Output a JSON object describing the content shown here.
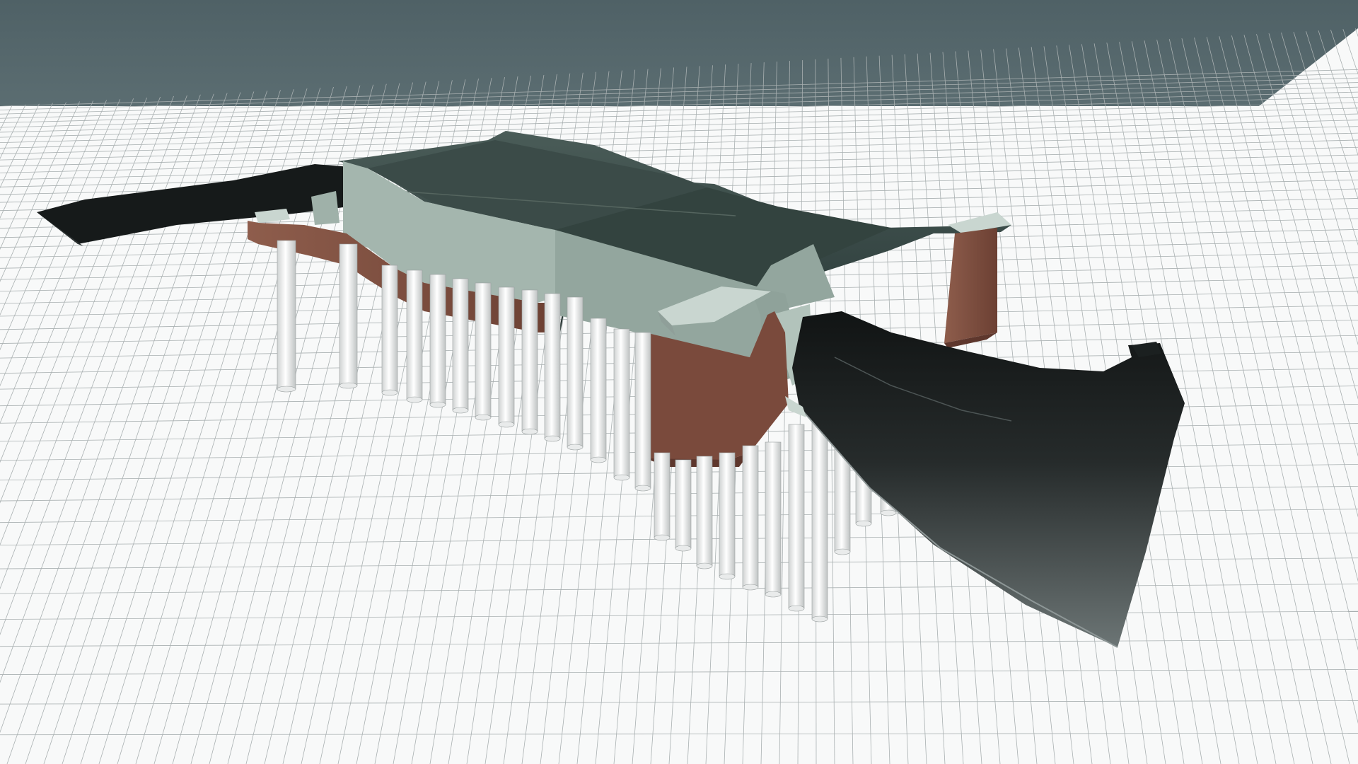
{
  "viewport": {
    "view_mode": "3d-perspective",
    "background_style": "gradient-horizon"
  },
  "scene": {
    "model": "bridge-abutment-with-piles",
    "colors": {
      "sky_top": "#4f6166",
      "sky_horizon": "#dde6e6",
      "grid_ground": "#f8f9f9",
      "grid_line": "#a9b0b1",
      "concrete_top": "#3d4d4b",
      "concrete_side": "#8fa19a",
      "concrete_light": "#a9bab3",
      "brick": "#8c5a4a",
      "brick_dark": "#6f4236",
      "asphalt_dark": "#151818",
      "asphalt_mid": "#3c4444",
      "pile_light": "#f2f2f2",
      "pile_shadow": "#c3c6c6"
    }
  }
}
